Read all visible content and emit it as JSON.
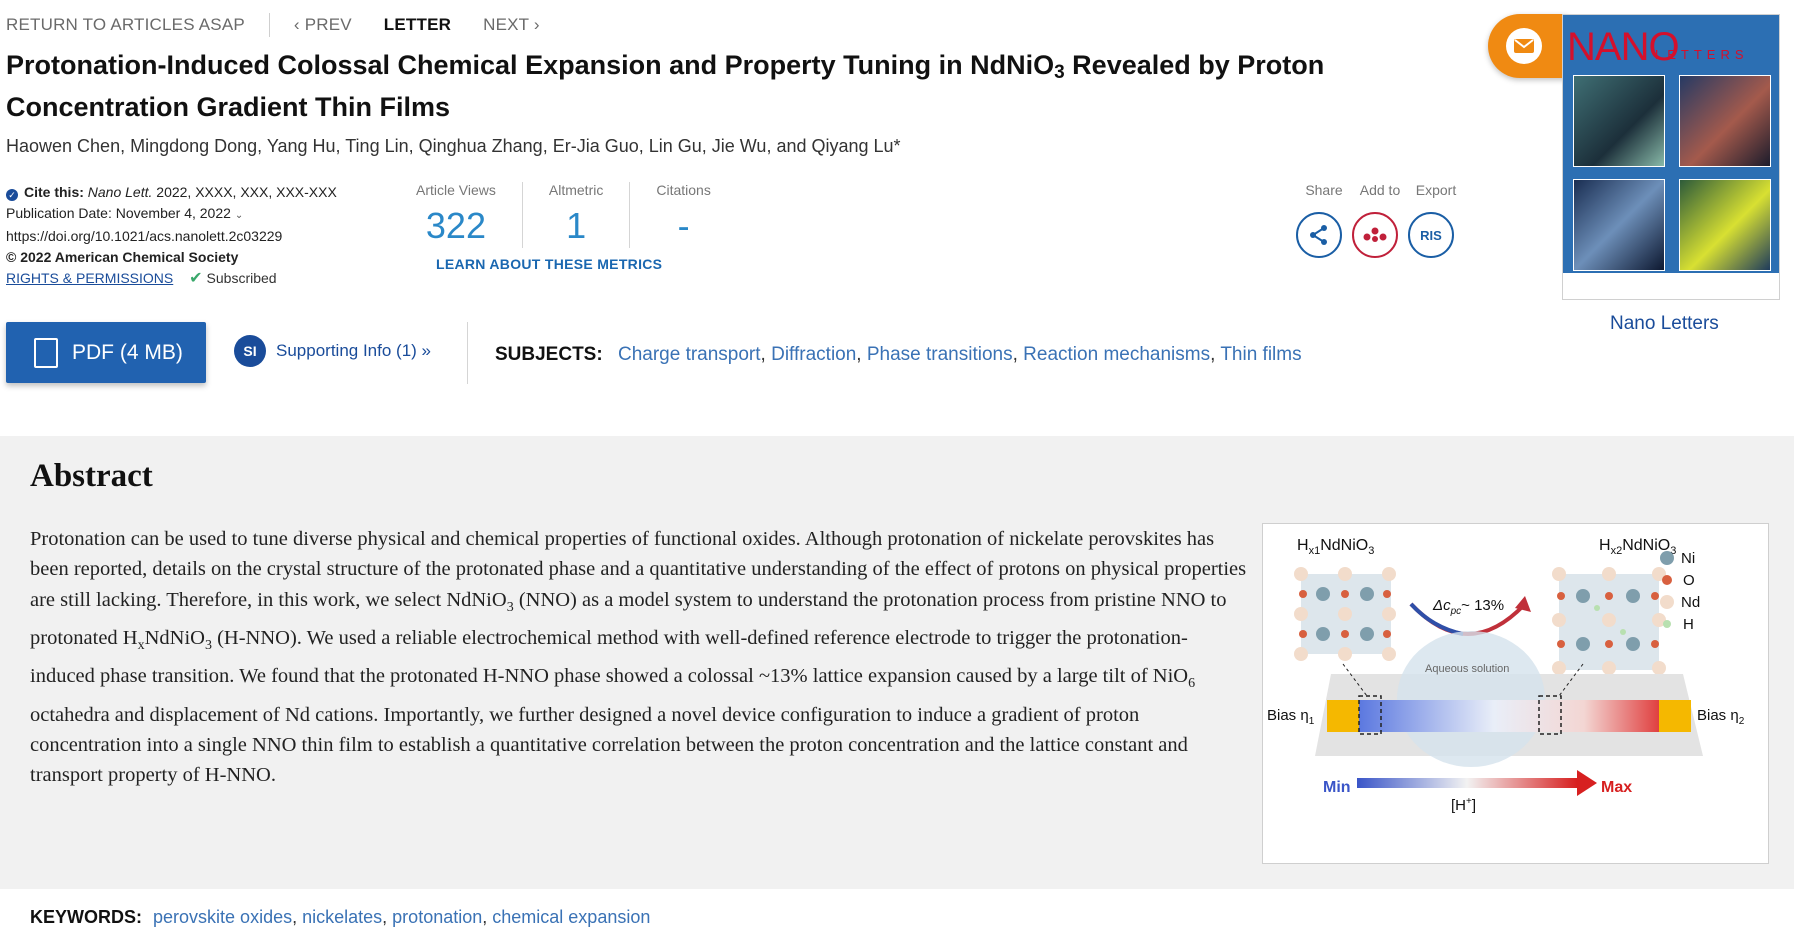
{
  "nav": {
    "return_label": "RETURN TO ARTICLES ASAP",
    "prev_label": "PREV",
    "type_label": "LETTER",
    "next_label": "NEXT"
  },
  "article": {
    "title_part1": "Protonation-Induced Colossal Chemical Expansion and Property Tuning in NdNiO",
    "title_sub": "3",
    "title_part2": " Revealed by Proton Concentration Gradient Thin Films",
    "authors": "Haowen Chen, Mingdong Dong, Yang Hu, Ting Lin, Qinghua Zhang, Er-Jia Guo, Lin Gu, Jie Wu, and Qiyang Lu*",
    "cite_label": "Cite this:",
    "cite_journal": "Nano Lett.",
    "cite_ref": "2022, XXXX, XXX, XXX-XXX",
    "pub_date": "Publication Date: November 4, 2022",
    "doi": "https://doi.org/10.1021/acs.nanolett.2c03229",
    "copyright": "© 2022 American Chemical Society",
    "rights_link": "RIGHTS & PERMISSIONS",
    "subscribed": "Subscribed"
  },
  "metrics": {
    "views_label": "Article Views",
    "views_value": "322",
    "altmetric_label": "Altmetric",
    "altmetric_value": "1",
    "citations_label": "Citations",
    "citations_value": "-",
    "learn_link": "LEARN ABOUT THESE METRICS"
  },
  "tools": {
    "share_label": "Share",
    "add_label": "Add to",
    "export_label": "Export",
    "ris_label": "RIS"
  },
  "journal": {
    "cover_nano": "NANO",
    "cover_letters": "LETTERS",
    "caption": "Nano Letters"
  },
  "actions": {
    "pdf_label": "PDF (4 MB)",
    "si_badge": "SI",
    "si_label": "Supporting Info (1) »",
    "subjects_label": "SUBJECTS:",
    "subjects": [
      "Charge transport",
      "Diffraction",
      "Phase transitions",
      "Reaction mechanisms",
      "Thin films"
    ]
  },
  "abstract": {
    "heading": "Abstract",
    "p1": "Protonation can be used to tune diverse physical and chemical properties of functional oxides. Although protonation of nickelate perovskites has been reported, details on the crystal structure of the protonated phase and a quantitative understanding of the effect of protons on physical properties are still lacking. Therefore, in this work, we select NdNiO",
    "p1_sub": "3",
    "p2": " (NNO) as a model system to understand the protonation process from pristine NNO to protonated H",
    "p2_sub_x": "x",
    "p3": "NdNiO",
    "p3_sub": "3",
    "p4": " (H-NNO). We used a reliable electrochemical method with well-defined reference electrode to trigger the protonation-induced phase transition. We found that the protonated H-NNO phase showed a colossal ~13% lattice expansion caused by a large tilt of NiO",
    "p4_sub": "6",
    "p5": " octahedra and displacement of Nd cations. Importantly, we further designed a novel device configuration to induce a gradient of proton concentration into a single NNO thin film to establish a quantitative correlation between the proton concentration and the lattice constant and transport property of H-NNO."
  },
  "toc": {
    "left_label_main": "H",
    "left_label_sub": "x1",
    "left_label_rest": "NdNiO",
    "left_label_sub2": "3",
    "right_label_main": "H",
    "right_label_sub": "x2",
    "right_label_rest": "NdNiO",
    "right_label_sub2": "3",
    "expansion_label": "Δc",
    "expansion_sub": "pc",
    "expansion_value": "~ 13%",
    "legend": [
      "Ni",
      "O",
      "Nd",
      "H"
    ],
    "aqueous": "Aqueous solution",
    "bias_left": "Bias η",
    "bias_left_sub": "1",
    "bias_right": "Bias η",
    "bias_right_sub": "2",
    "min_label": "Min",
    "max_label": "Max",
    "h_label": "[H",
    "h_sup": "+",
    "h_end": "]"
  },
  "keywords": {
    "label": "KEYWORDS:",
    "items": [
      "perovskite oxides",
      "nickelates",
      "protonation",
      "chemical expansion"
    ]
  },
  "colors": {
    "accent_blue": "#2162b0",
    "metric_blue": "#2a88c8",
    "link_blue": "#3a72b5",
    "mail_orange": "#f08a12",
    "cover_red": "#d4102c"
  }
}
